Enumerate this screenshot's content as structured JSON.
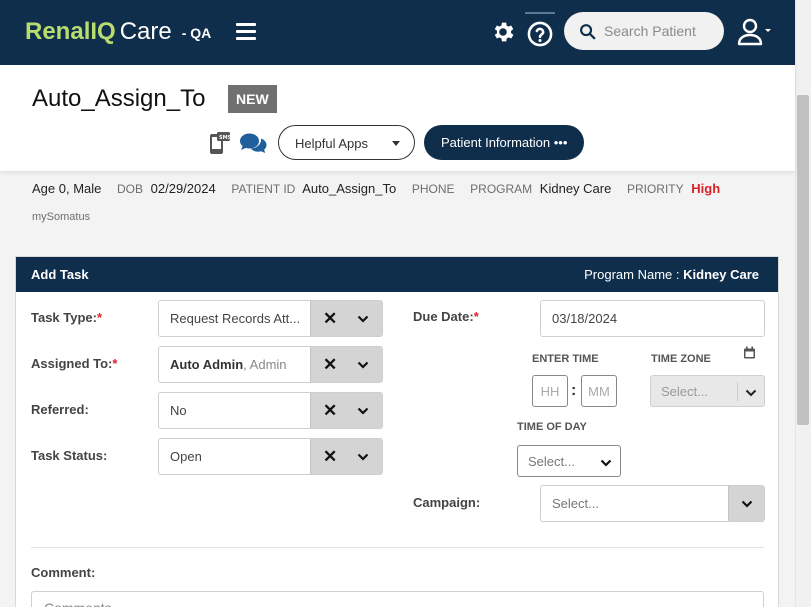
{
  "nav": {
    "brand_renal": "Renal",
    "brand_iq": "IQ",
    "brand_care": "Care",
    "env": "- QA",
    "search_placeholder": "Search Patient"
  },
  "header": {
    "patient_name": "Auto_Assign_To",
    "badge": "NEW",
    "helpful_apps": "Helpful Apps",
    "patient_info": "Patient Information •••"
  },
  "demographics": {
    "age_sex": "Age 0, Male",
    "dob_label": "DOB",
    "dob": "02/29/2024",
    "patient_id_label": "PATIENT ID",
    "patient_id": "Auto_Assign_To",
    "phone_label": "PHONE",
    "program_label": "PROGRAM",
    "program": "Kidney Care",
    "priority_label": "PRIORITY",
    "priority": "High",
    "org": "mySomatus"
  },
  "task": {
    "title": "Add Task",
    "program_label": "Program Name :",
    "program_value": "Kidney Care",
    "task_type_label": "Task Type:",
    "task_type_value": "Request Records Att...",
    "assigned_label": "Assigned To:",
    "assigned_name": "Auto Admin",
    "assigned_role": ", Admin",
    "referred_label": "Referred:",
    "referred_value": "No",
    "status_label": "Task Status:",
    "status_value": "Open",
    "due_label": "Due Date:",
    "due_value": "03/18/2024",
    "enter_time_label": "ENTER TIME",
    "hh_placeholder": "HH",
    "mm_placeholder": "MM",
    "time_zone_label": "TIME ZONE",
    "time_zone_value": "Select...",
    "time_of_day_label": "TIME OF DAY",
    "time_of_day_value": "Select...",
    "campaign_label": "Campaign:",
    "campaign_value": "Select...",
    "comment_label": "Comment:",
    "comment_placeholder": "Comments",
    "required_mark": "*",
    "clear_glyph": "✕"
  },
  "colors": {
    "nav_bg": "#0f2e4c",
    "brand_green": "#b9dc6f",
    "priority_red": "#d8232a"
  }
}
